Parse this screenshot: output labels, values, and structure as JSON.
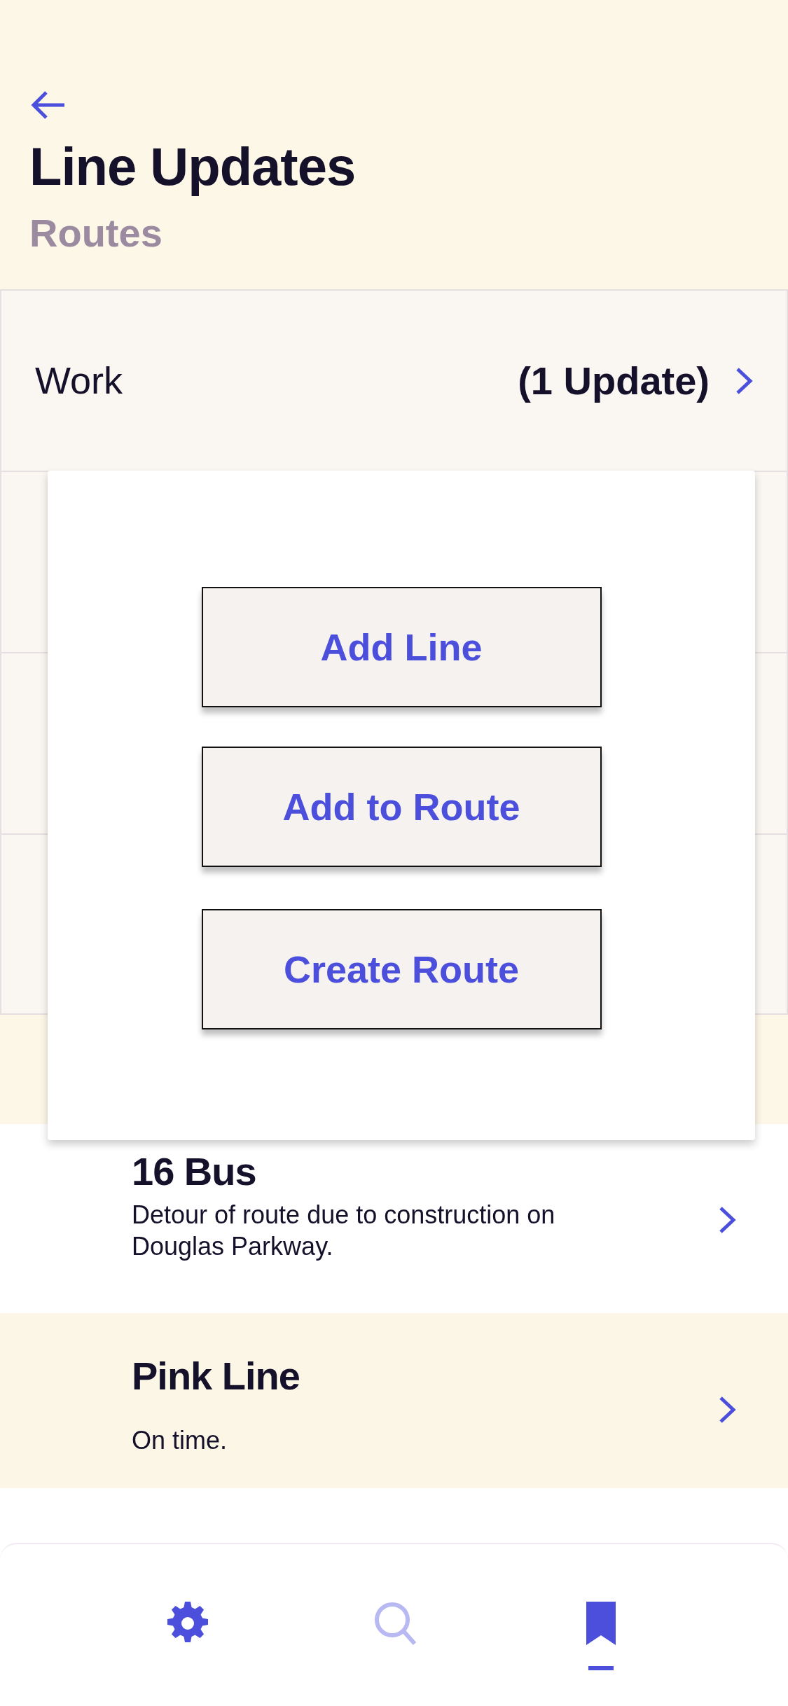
{
  "header": {
    "title": "Line Updates"
  },
  "routes": {
    "heading": "Routes",
    "items": [
      {
        "name": "Work",
        "updates": "(1 Update)"
      }
    ]
  },
  "lines": {
    "items": [
      {
        "name": "16 Bus",
        "status": "Detour of route due to construction on Douglas Parkway.",
        "highlighted": false
      },
      {
        "name": "Pink Line",
        "status": "On time.",
        "highlighted": true
      }
    ]
  },
  "menu": {
    "buttons": [
      "Add Line",
      "Add to Route",
      "Create Route"
    ]
  },
  "bottom_nav": [
    {
      "kind": "settings",
      "selected": false,
      "disabled": false
    },
    {
      "kind": "search",
      "selected": false,
      "disabled": true
    },
    {
      "kind": "saved",
      "selected": true,
      "disabled": false
    }
  ]
}
